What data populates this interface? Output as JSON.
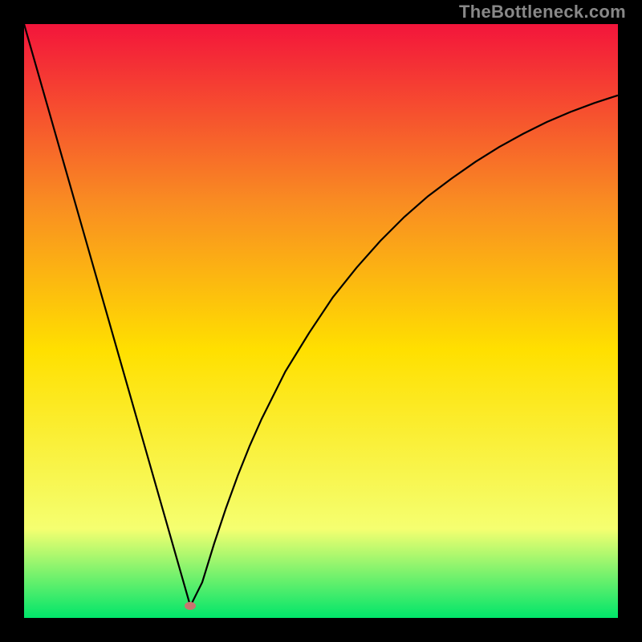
{
  "watermark": "TheBottleneck.com",
  "chart_data": {
    "type": "line",
    "title": "",
    "xlabel": "",
    "ylabel": "",
    "xlim": [
      0,
      100
    ],
    "ylim": [
      0,
      100
    ],
    "grid": false,
    "legend": false,
    "annotations": [],
    "gradient_colors": {
      "top": "#f3153b",
      "upper_mid": "#f98c22",
      "mid": "#ffe000",
      "lower": "#f5ff70",
      "bottom": "#00e56a"
    },
    "marker": {
      "x": 28,
      "y": 2,
      "color": "#c97570"
    },
    "series": [
      {
        "name": "curve",
        "color": "#000000",
        "x": [
          0,
          2,
          4,
          6,
          8,
          10,
          12,
          14,
          16,
          18,
          20,
          22,
          24,
          26,
          28,
          30,
          32,
          34,
          36,
          38,
          40,
          44,
          48,
          52,
          56,
          60,
          64,
          68,
          72,
          76,
          80,
          84,
          88,
          92,
          96,
          100
        ],
        "y": [
          100,
          93,
          86,
          79,
          72,
          65,
          58,
          51,
          44,
          37,
          30,
          23,
          16,
          9,
          2,
          6,
          12.5,
          18.5,
          24,
          29,
          33.5,
          41.5,
          48,
          54,
          59,
          63.5,
          67.5,
          71,
          74,
          76.8,
          79.3,
          81.5,
          83.5,
          85.2,
          86.7,
          88
        ]
      }
    ]
  }
}
